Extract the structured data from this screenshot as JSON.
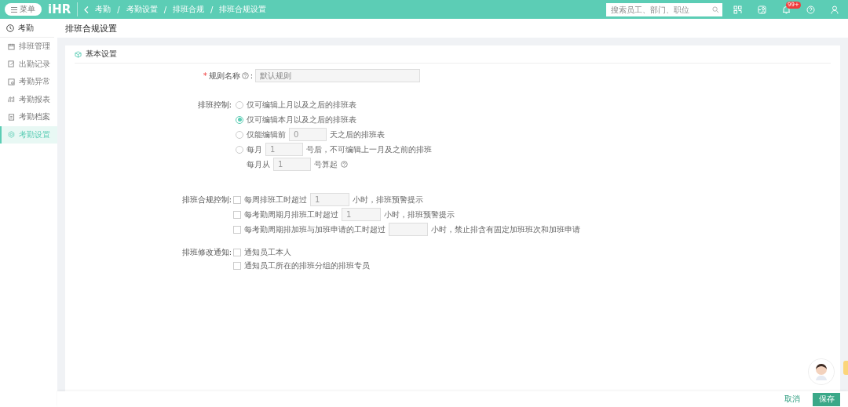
{
  "header": {
    "menu_button": "菜单",
    "logo": "iHR",
    "breadcrumb_separator": "/",
    "breadcrumb": [
      {
        "label": "考勤"
      },
      {
        "label": "考勤设置"
      },
      {
        "label": "排班合规"
      },
      {
        "label": "排班合规设置"
      }
    ],
    "search": {
      "placeholder": "搜索员工、部门、职位"
    },
    "notification_badge": "99+"
  },
  "sidebar": {
    "title": "考勤",
    "items": [
      {
        "label": "排班管理",
        "selected": false
      },
      {
        "label": "出勤记录",
        "selected": false
      },
      {
        "label": "考勤异常",
        "selected": false
      },
      {
        "label": "考勤报表",
        "selected": false
      },
      {
        "label": "考勤档案",
        "selected": false
      },
      {
        "label": "考勤设置",
        "selected": true
      }
    ]
  },
  "page_title": "排班合规设置",
  "section_title": "基本设置",
  "rule_name": {
    "required_mark": "*",
    "label": "规则名称",
    "colon": ":",
    "placeholder": "默认规则"
  },
  "schedule_control": {
    "label": "排班控制:",
    "options": [
      {
        "kind": "plain",
        "text": "仅可编辑上月以及之后的排班表",
        "selected": false
      },
      {
        "kind": "plain",
        "text": "仅可编辑本月以及之后的排班表",
        "selected": true
      },
      {
        "kind": "input",
        "before": "仅能编辑前",
        "value": "0",
        "after": "天之后的排班表",
        "selected": false
      },
      {
        "kind": "input",
        "before": "每月",
        "value": "1",
        "after": "号后，不可编辑上一月及之前的排班",
        "selected": false
      }
    ],
    "start_row": {
      "before": "每月从",
      "value": "1",
      "after": "号算起"
    }
  },
  "compliance_control": {
    "label": "排班合规控制:",
    "items": [
      {
        "before": "每周排班工时超过",
        "value": "1",
        "after": "小时，排班预警提示",
        "checked": false
      },
      {
        "before": "每考勤周期月排班工时超过",
        "value": "1",
        "after": "小时，排班预警提示",
        "checked": false
      },
      {
        "before": "每考勤周期排加班与加班申请的工时超过",
        "after": "小时，禁止排含有固定加班班次和加班申请",
        "checked": false
      }
    ]
  },
  "notify": {
    "label": "排班修改通知:",
    "items": [
      {
        "text": "通知员工本人",
        "checked": false
      },
      {
        "text": "通知员工所在的排班分组的排班专员",
        "checked": false
      }
    ]
  },
  "footer": {
    "cancel": "取消",
    "save": "保存"
  }
}
